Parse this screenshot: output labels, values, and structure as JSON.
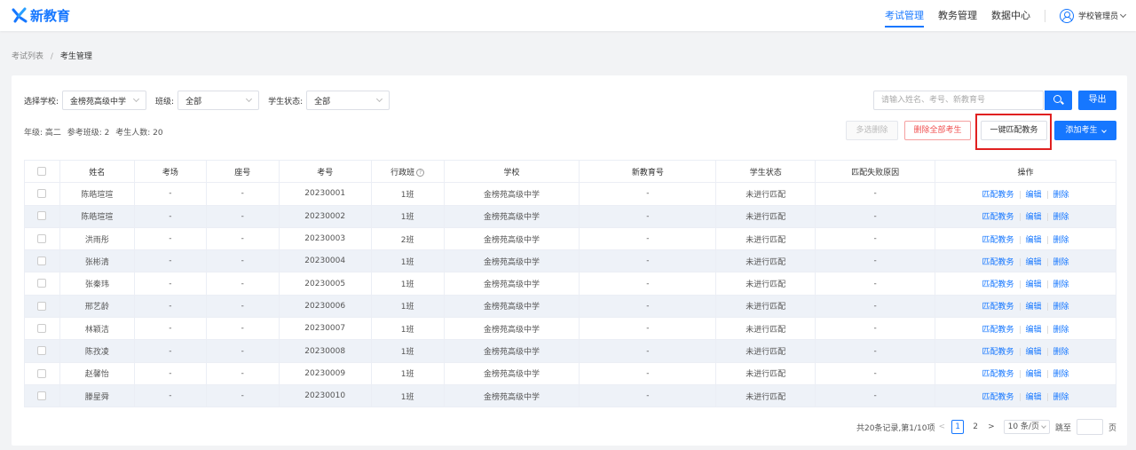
{
  "header": {
    "logo_text": "新教育",
    "nav": [
      "考试管理",
      "教务管理",
      "数据中心"
    ],
    "active_nav": "考试管理",
    "user_name": "学校管理员"
  },
  "breadcrumb": [
    "考试列表",
    "考生管理"
  ],
  "filters": {
    "school_label": "选择学校:",
    "school_value": "金榜苑高级中学",
    "class_label": "班级:",
    "class_value": "全部",
    "status_label": "学生状态:",
    "status_value": "全部"
  },
  "search": {
    "placeholder": "请输入姓名、考号、新教育号"
  },
  "buttons": {
    "export": "导出",
    "multi_delete": "多选删除",
    "delete_all": "删除全部考生",
    "one_click_match": "一键匹配教务",
    "add_student": "添加考生"
  },
  "summary": {
    "grade": "年级: 高二",
    "classes": "参考班级: 2",
    "count": "考生人数: 20"
  },
  "table": {
    "headers": [
      "姓名",
      "考场",
      "座号",
      "考号",
      "行政班",
      "学校",
      "新教育号",
      "学生状态",
      "匹配失败原因",
      "操作"
    ],
    "rows": [
      [
        "陈皓瑄瑄",
        "-",
        "-",
        "20230001",
        "1班",
        "金榜苑高级中学",
        "-",
        "未进行匹配",
        "-"
      ],
      [
        "陈皓瑄瑄",
        "-",
        "-",
        "20230002",
        "1班",
        "金榜苑高级中学",
        "-",
        "未进行匹配",
        "-"
      ],
      [
        "洪雨彤",
        "-",
        "-",
        "20230003",
        "2班",
        "金榜苑高级中学",
        "-",
        "未进行匹配",
        "-"
      ],
      [
        "张彬清",
        "-",
        "-",
        "20230004",
        "1班",
        "金榜苑高级中学",
        "-",
        "未进行匹配",
        "-"
      ],
      [
        "张秦玮",
        "-",
        "-",
        "20230005",
        "1班",
        "金榜苑高级中学",
        "-",
        "未进行匹配",
        "-"
      ],
      [
        "邢艺龄",
        "-",
        "-",
        "20230006",
        "1班",
        "金榜苑高级中学",
        "-",
        "未进行匹配",
        "-"
      ],
      [
        "林颖洁",
        "-",
        "-",
        "20230007",
        "1班",
        "金榜苑高级中学",
        "-",
        "未进行匹配",
        "-"
      ],
      [
        "陈孜凌",
        "-",
        "-",
        "20230008",
        "1班",
        "金榜苑高级中学",
        "-",
        "未进行匹配",
        "-"
      ],
      [
        "赵馨怡",
        "-",
        "-",
        "20230009",
        "1班",
        "金榜苑高级中学",
        "-",
        "未进行匹配",
        "-"
      ],
      [
        "滕星舜",
        "-",
        "-",
        "20230010",
        "1班",
        "金榜苑高级中学",
        "-",
        "未进行匹配",
        "-"
      ]
    ],
    "actions": [
      "匹配教务",
      "编辑",
      "删除"
    ]
  },
  "pagination": {
    "summary": "共20条记录,第1/10项",
    "pages": [
      "1",
      "2"
    ],
    "current_page": "1",
    "page_size": "10 条/页",
    "goto_label": "跳至",
    "page_unit": "页"
  },
  "colors": {
    "primary": "#1677ff",
    "status": "#f56c00",
    "danger": "#f05050",
    "highlight": "#e02020"
  }
}
